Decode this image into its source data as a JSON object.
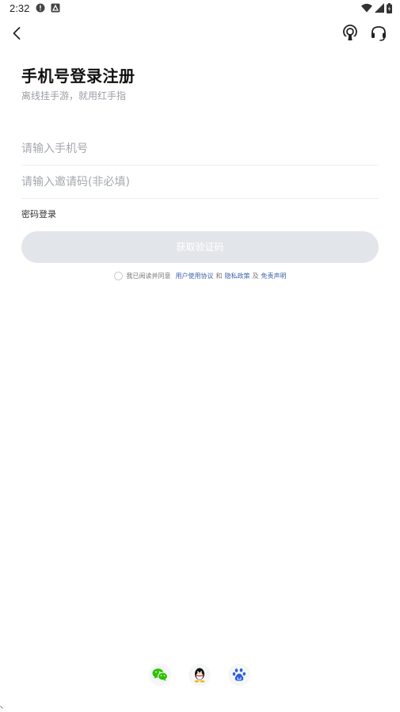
{
  "status_bar": {
    "time": "2:32"
  },
  "header": {
    "title": "手机号登录注册",
    "subtitle": "离线挂手游，就用红手指"
  },
  "form": {
    "phone_placeholder": "请输入手机号",
    "invite_placeholder": "请输入邀请码(非必填)",
    "password_login_label": "密码登录",
    "get_code_label": "获取验证码"
  },
  "agreement": {
    "prefix": "我已阅读并同意",
    "user_agreement": "用户使用协议",
    "and": "和",
    "privacy_policy": "隐私政策",
    "and2": "及",
    "disclaimer": "免责声明"
  },
  "social_login": {
    "items": [
      "wechat-icon",
      "qq-icon",
      "baidu-icon"
    ]
  },
  "colors": {
    "button_disabled_bg": "#e2e6ea",
    "link": "#3d63a8",
    "wechat": "#2dc100",
    "baidu": "#2a5fe0"
  }
}
